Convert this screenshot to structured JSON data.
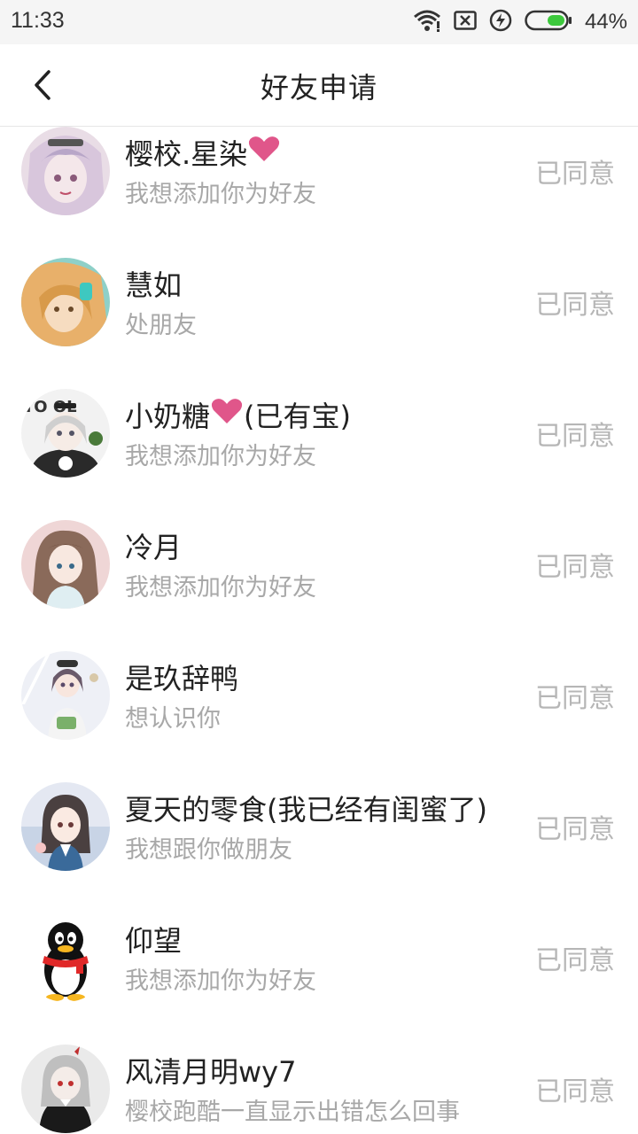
{
  "status_bar": {
    "time": "11:33",
    "battery": "44%",
    "icons": [
      "wifi-icon",
      "sim-icon",
      "charging-icon",
      "battery-icon"
    ],
    "battery_color": "#3cc83c"
  },
  "header": {
    "back_icon": "chevron-left-icon",
    "title": "好友申请"
  },
  "requests": [
    {
      "name": "樱校.星染",
      "heart_after": true,
      "suffix": "",
      "message": "我想添加你为好友",
      "status": "已同意"
    },
    {
      "name": "慧如",
      "heart_after": false,
      "suffix": "",
      "message": "处朋友",
      "status": "已同意"
    },
    {
      "name": "小奶糖",
      "heart_after": true,
      "suffix": "(已有宝)",
      "message": "我想添加你为好友",
      "status": "已同意"
    },
    {
      "name": "冷月",
      "heart_after": false,
      "suffix": "",
      "message": "我想添加你为好友",
      "status": "已同意"
    },
    {
      "name": "是玖辞鸭",
      "heart_after": false,
      "suffix": "",
      "message": "想认识你",
      "status": "已同意"
    },
    {
      "name": "夏天的零食(我已经有闺蜜了)",
      "heart_after": false,
      "suffix": "",
      "message": "我想跟你做朋友",
      "status": "已同意"
    },
    {
      "name": "仰望",
      "heart_after": false,
      "suffix": "",
      "message": "我想添加你为好友",
      "status": "已同意"
    },
    {
      "name": "风清月明wy7",
      "heart_after": false,
      "suffix": "",
      "message": "樱校跑酷一直显示出错怎么回事",
      "status": "已同意"
    }
  ],
  "colors": {
    "heart": "#e0568a",
    "status_text": "#b6b6b6",
    "message_text": "#a8a8a8"
  }
}
